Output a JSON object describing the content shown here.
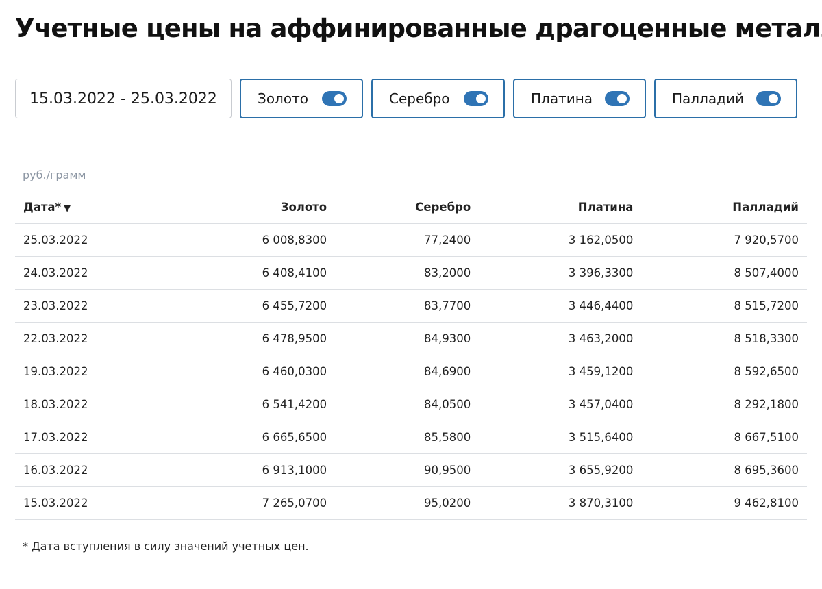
{
  "title": "Учетные цены на аффинированные драгоценные металлы",
  "filters": {
    "date_range": "15.03.2022 - 25.03.2022",
    "metals": [
      {
        "label": "Золото",
        "enabled": true
      },
      {
        "label": "Серебро",
        "enabled": true
      },
      {
        "label": "Платина",
        "enabled": true
      },
      {
        "label": "Палладий",
        "enabled": true
      }
    ]
  },
  "unit": "руб./грамм",
  "table": {
    "headers": {
      "date": "Дата*",
      "sort_indicator": "▼",
      "gold": "Золото",
      "silver": "Серебро",
      "platinum": "Платина",
      "palladium": "Палладий"
    },
    "rows": [
      [
        "25.03.2022",
        "6 008,8300",
        "77,2400",
        "3 162,0500",
        "7 920,5700"
      ],
      [
        "24.03.2022",
        "6 408,4100",
        "83,2000",
        "3 396,3300",
        "8 507,4000"
      ],
      [
        "23.03.2022",
        "6 455,7200",
        "83,7700",
        "3 446,4400",
        "8 515,7200"
      ],
      [
        "22.03.2022",
        "6 478,9500",
        "84,9300",
        "3 463,2000",
        "8 518,3300"
      ],
      [
        "19.03.2022",
        "6 460,0300",
        "84,6900",
        "3 459,1200",
        "8 592,6500"
      ],
      [
        "18.03.2022",
        "6 541,4200",
        "84,0500",
        "3 457,0400",
        "8 292,1800"
      ],
      [
        "17.03.2022",
        "6 665,6500",
        "85,5800",
        "3 515,6400",
        "8 667,5100"
      ],
      [
        "16.03.2022",
        "6 913,1000",
        "90,9500",
        "3 655,9200",
        "8 695,3600"
      ],
      [
        "15.03.2022",
        "7 265,0700",
        "95,0200",
        "3 870,3100",
        "9 462,8100"
      ]
    ]
  },
  "footnote": "* Дата вступления в силу значений учетных цен.",
  "colors": {
    "accent": "#2f74b5",
    "border_accent": "#2b6fa8",
    "muted_text": "#8c96a3"
  }
}
